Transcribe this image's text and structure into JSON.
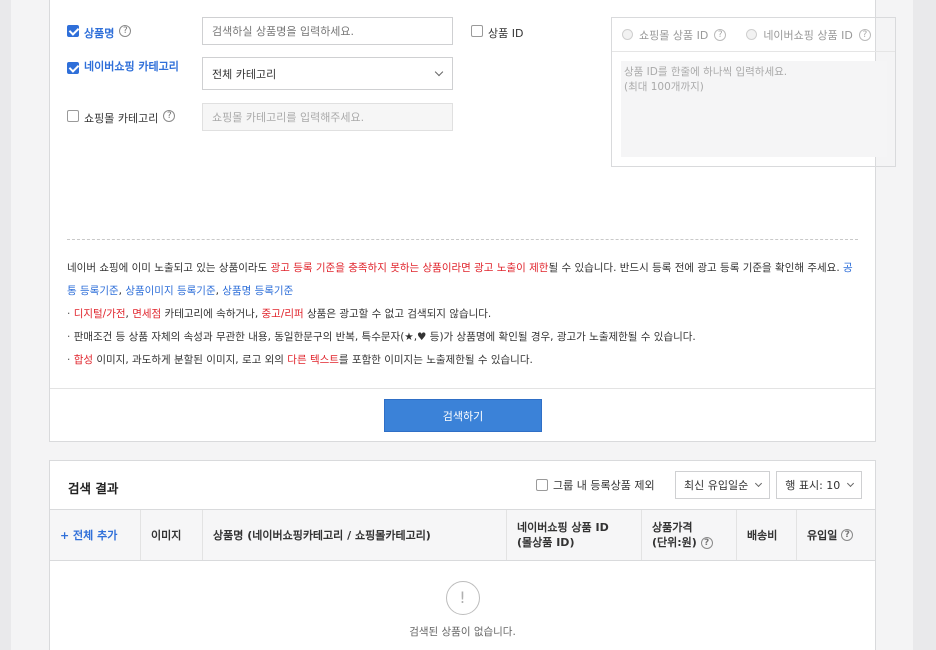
{
  "search_form": {
    "product_name_label": "상품명",
    "product_name_placeholder": "검색하실 상품명을 입력하세요.",
    "naver_category_label": "네이버쇼핑 카테고리",
    "naver_category_value": "전체 카테고리",
    "mall_category_label": "쇼핑몰 카테고리",
    "mall_category_placeholder": "쇼핑몰 카테고리를 입력해주세요.",
    "product_id_label": "상품 ID",
    "mall_product_id_label": "쇼핑몰 상품 ID",
    "naver_product_id_label": "네이버쇼핑 상품 ID",
    "id_textarea_placeholder_line1": "상품 ID를 한줄에 하나씩 입력하세요.",
    "id_textarea_placeholder_line2": "(최대 100개까지)"
  },
  "notice": {
    "p1_a": "네이버 쇼핑에 이미 노출되고 있는 상품이라도 ",
    "p1_red": "광고 등록 기준을 충족하지 못하는 상품이라면 광고 노출이 제한",
    "p1_b": "될 수 있습니다. 반드시 등록 전에 광고 등록 기준을 확인해 주세요. ",
    "link1": "공통 등록기준",
    "sep1": ", ",
    "link2": "상품이미지 등록기준",
    "sep2": ", ",
    "link3": "상품명 등록기준",
    "b1_red1": "디지털/가전",
    "b1_sep": ", ",
    "b1_red2": "면세점",
    "b1_mid": " 카테고리에 속하거나, ",
    "b1_red3": "중고/리퍼",
    "b1_end": " 상품은 광고할 수 없고 검색되지 않습니다.",
    "b2": "판매조건 등 상품 자체의 속성과 무관한 내용, 동일한문구의 반복, 특수문자(★,♥ 등)가 상품명에 확인될 경우, 광고가 노출제한될 수 있습니다.",
    "b3_red1": "합성",
    "b3_mid": " 이미지, 과도하게 분할된 이미지, 로고 외의 ",
    "b3_red2": "다른 텍스트",
    "b3_end": "를 포함한 이미지는 노출제한될 수 있습니다."
  },
  "search_button": "검색하기",
  "results": {
    "title": "검색 결과",
    "exclude_label": "그룹 내 등록상품 제외",
    "sort_value": "최신 유입일순",
    "rows_value": "행 표시: 10",
    "columns": {
      "add_all": "+ 전체 추가",
      "image": "이미지",
      "product_name": "상품명 (네이버쇼핑카테고리 / 쇼핑몰카테고리)",
      "naver_id_line1": "네이버쇼핑 상품 ID",
      "naver_id_line2": "(몰상품 ID)",
      "price_line1": "상품가격",
      "price_line2": "(단위:원)",
      "shipping": "배송비",
      "inflow_date": "유입일"
    },
    "empty_icon": "!",
    "empty_text": "검색된 상품이 없습니다."
  },
  "colors": {
    "accent": "#2f6fd9",
    "warning": "#e0242c",
    "button": "#3b82d8"
  }
}
